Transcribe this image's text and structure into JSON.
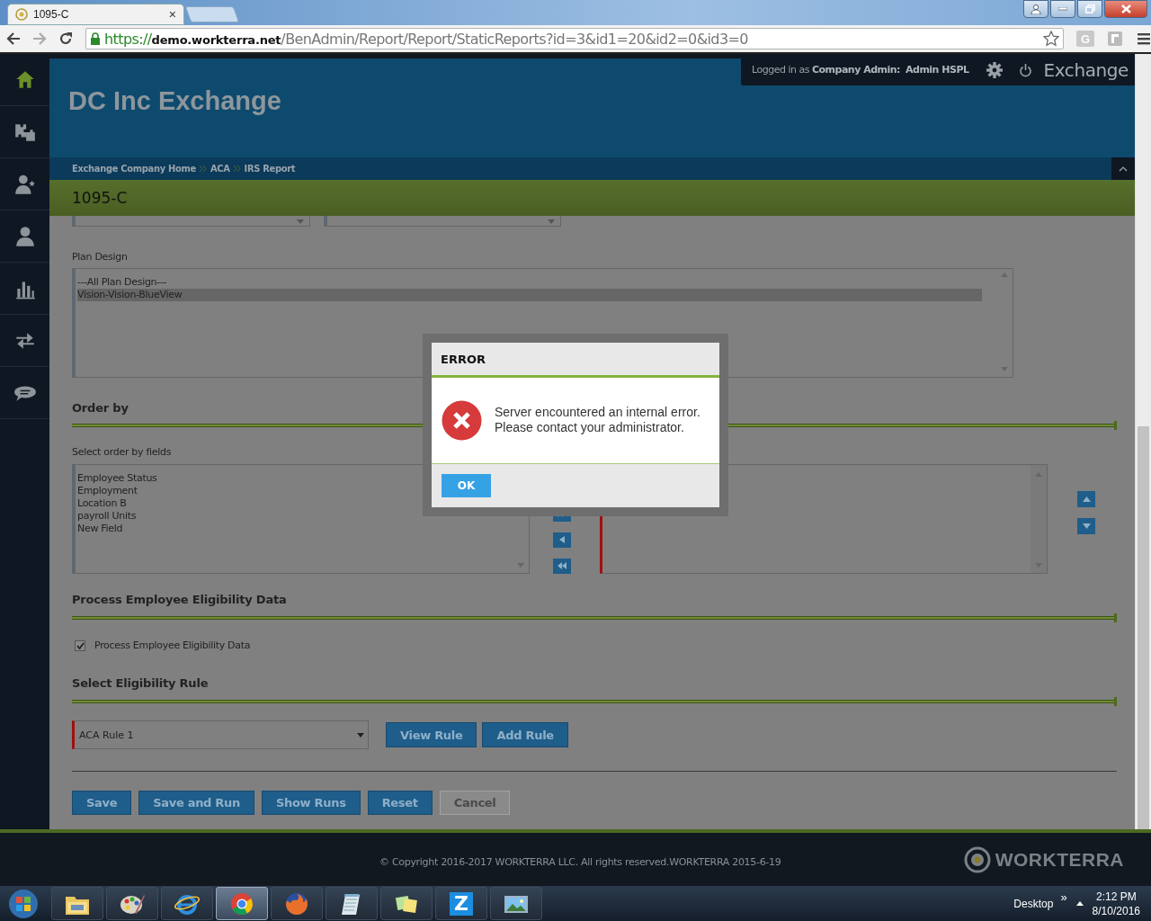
{
  "browser": {
    "tab_title": "1095-C",
    "tab_close": "×",
    "url_scheme": "https://",
    "url_host": "demo.workterra.net",
    "url_path": "/BenAdmin/Report/Report/StaticReports?id=3&id1=20&id2=0&id3=0",
    "extension_letter": "G"
  },
  "sidebar": {
    "items": [
      {
        "kind": "home",
        "selected": true
      },
      {
        "kind": "puzzle",
        "selected": false
      },
      {
        "kind": "person-star",
        "selected": false
      },
      {
        "kind": "person",
        "selected": false
      },
      {
        "kind": "chart",
        "selected": false
      },
      {
        "kind": "arrows",
        "selected": false
      },
      {
        "kind": "chat",
        "selected": false
      }
    ]
  },
  "header": {
    "title": "DC Inc Exchange",
    "login_status": "Logged in as **Company Admin:**  **Admin HSPL**",
    "app_name": "Exchange"
  },
  "breadcrumb": [
    "Exchange Company Home",
    "ACA",
    "IRS Report"
  ],
  "page_title": "1095-C",
  "plan_design": {
    "label": "Plan Design",
    "options": [
      {
        "label": "---All Plan Design---",
        "selected": false
      },
      {
        "label": "Vision-Vision-BlueView",
        "selected": true
      }
    ]
  },
  "order_by": {
    "heading": "Order by",
    "label": "Select order by fields",
    "available": [
      "Employee Status",
      "Employment",
      "Location B",
      "payroll Units",
      "New Field"
    ]
  },
  "eligibility": {
    "heading": "Process Employee Eligibility Data",
    "checkbox": {
      "label": "Process Employee Eligibility Data",
      "checked": true
    }
  },
  "rule": {
    "heading": "Select Eligibility Rule",
    "value": "ACA Rule 1",
    "buttons": [
      "View Rule",
      "Add Rule"
    ]
  },
  "actions": [
    {
      "label": "Save",
      "kind": "primary"
    },
    {
      "label": "Save and Run",
      "kind": "primary"
    },
    {
      "label": "Show Runs",
      "kind": "primary"
    },
    {
      "label": "Reset",
      "kind": "primary"
    },
    {
      "label": "Cancel",
      "kind": "secondary"
    }
  ],
  "footer": {
    "copyright": "© Copyright 2016-2017 WORKTERRA LLC. All rights reserved.WORKTERRA 2015-6-19",
    "logo": "WORKTERRA"
  },
  "dialog": {
    "title": "ERROR",
    "message": "Server encountered an internal error.\nPlease contact your administrator.",
    "button": "OK"
  },
  "taskbar": {
    "apps": [
      {
        "kind": "folder",
        "selected": false
      },
      {
        "kind": "palette",
        "selected": false
      },
      {
        "kind": "ie",
        "selected": false
      },
      {
        "kind": "chrome",
        "selected": true
      },
      {
        "kind": "firefox",
        "selected": false
      },
      {
        "kind": "notepad",
        "selected": false
      },
      {
        "kind": "notes",
        "selected": false
      },
      {
        "kind": "letter",
        "glyph": "Z",
        "selected": false
      },
      {
        "kind": "photo",
        "selected": false
      }
    ],
    "desktop": "Desktop",
    "more": "»",
    "time": "2:12 PM",
    "date": "8/10/2016"
  }
}
